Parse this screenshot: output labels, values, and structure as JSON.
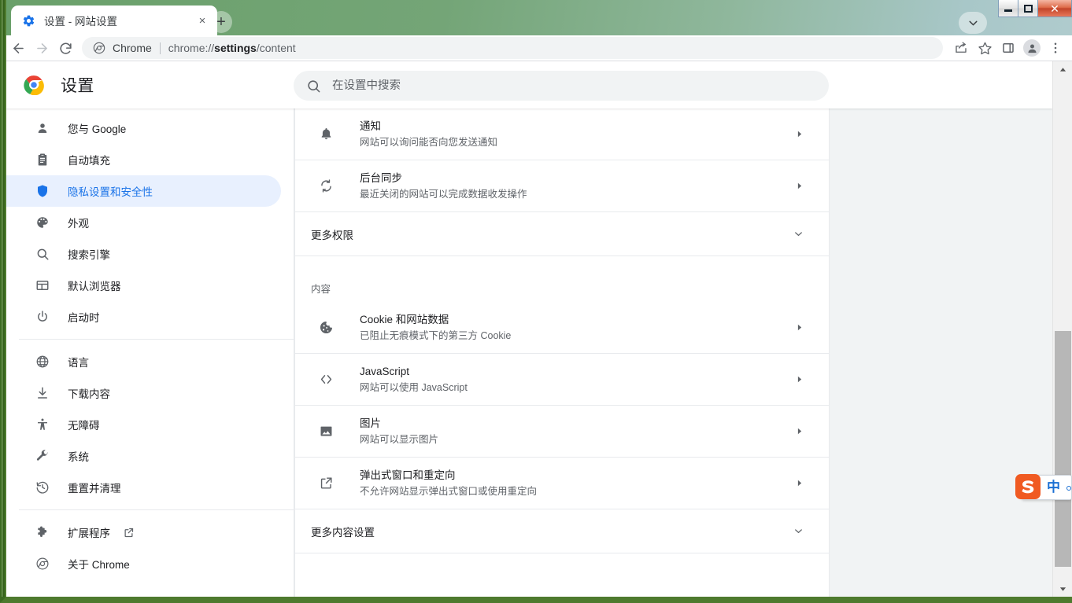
{
  "window": {
    "minimize_label": "Minimize",
    "maximize_label": "Maximize",
    "close_label": "Close"
  },
  "tabstrip": {
    "tab": {
      "title": "设置 - 网站设置",
      "favicon_icon": "gear-icon",
      "close_label": "×"
    },
    "new_tab_label": "+",
    "chevron_icon": "chevron-down-icon"
  },
  "toolbar": {
    "back_icon": "arrow-left-icon",
    "forward_icon": "arrow-right-icon",
    "reload_icon": "reload-icon",
    "omnibox": {
      "site_icon": "chrome-icon",
      "scheme_label": "Chrome",
      "url_prefix": "chrome://",
      "url_bold": "settings",
      "url_suffix": "/content"
    },
    "actions": [
      {
        "name": "share-icon",
        "label": "Share"
      },
      {
        "name": "star-icon",
        "label": "Bookmark"
      },
      {
        "name": "side-panel-icon",
        "label": "Side panel"
      },
      {
        "name": "profile-avatar-icon",
        "label": "Profile"
      },
      {
        "name": "more-vert-icon",
        "label": "More"
      }
    ]
  },
  "settings_header": {
    "logo_icon": "chrome-logo-icon",
    "title": "设置"
  },
  "search": {
    "icon": "search-icon",
    "placeholder": "在设置中搜索",
    "value": ""
  },
  "sidebar": {
    "items": [
      {
        "icon": "person-icon",
        "label": "您与 Google",
        "active": false
      },
      {
        "icon": "clipboard-icon",
        "label": "自动填充",
        "active": false
      },
      {
        "icon": "shield-icon",
        "label": "隐私设置和安全性",
        "active": true
      },
      {
        "icon": "palette-icon",
        "label": "外观",
        "active": false
      },
      {
        "icon": "search-icon",
        "label": "搜索引擎",
        "active": false
      },
      {
        "icon": "browser-icon",
        "label": "默认浏览器",
        "active": false
      },
      {
        "icon": "power-icon",
        "label": "启动时",
        "active": false
      }
    ],
    "items2": [
      {
        "icon": "globe-icon",
        "label": "语言",
        "active": false
      },
      {
        "icon": "download-icon",
        "label": "下载内容",
        "active": false
      },
      {
        "icon": "accessibility-icon",
        "label": "无障碍",
        "active": false
      },
      {
        "icon": "wrench-icon",
        "label": "系统",
        "active": false
      },
      {
        "icon": "history-icon",
        "label": "重置并清理",
        "active": false
      }
    ],
    "items3": [
      {
        "icon": "puzzle-icon",
        "label": "扩展程序",
        "external": true,
        "external_icon": "open-in-new-icon"
      },
      {
        "icon": "chrome-icon",
        "label": "关于 Chrome",
        "external": false
      }
    ]
  },
  "content": {
    "permission_rows": [
      {
        "icon": "bell-icon",
        "title": "通知",
        "subtitle": "网站可以询问能否向您发送通知",
        "arrow": "chevron-right-icon"
      },
      {
        "icon": "sync-icon",
        "title": "后台同步",
        "subtitle": "最近关闭的网站可以完成数据收发操作",
        "arrow": "chevron-right-icon"
      }
    ],
    "more_permissions": {
      "label": "更多权限",
      "arrow": "chevron-down-icon"
    },
    "section_title": "内容",
    "content_rows": [
      {
        "icon": "cookie-icon",
        "title": "Cookie 和网站数据",
        "subtitle": "已阻止无痕模式下的第三方 Cookie",
        "arrow": "chevron-right-icon"
      },
      {
        "icon": "code-icon",
        "title": "JavaScript",
        "subtitle": "网站可以使用 JavaScript",
        "arrow": "chevron-right-icon"
      },
      {
        "icon": "image-icon",
        "title": "图片",
        "subtitle": "网站可以显示图片",
        "arrow": "chevron-right-icon"
      },
      {
        "icon": "popup-icon",
        "title": "弹出式窗口和重定向",
        "subtitle": "不允许网站显示弹出式窗口或使用重定向",
        "arrow": "chevron-right-icon"
      }
    ],
    "more_content": {
      "label": "更多内容设置",
      "arrow": "chevron-down-icon"
    }
  },
  "scrollbar": {
    "up_icon": "triangle-up-icon",
    "down_icon": "triangle-down-icon"
  },
  "ime": {
    "logo_icon": "sogou-logo-icon",
    "mode_label": "中",
    "dot_icon": "circle-icon"
  },
  "colors": {
    "accent": "#1a73e8",
    "accent_bg": "#e8f0fe",
    "text_primary": "#202124",
    "text_secondary": "#5f6368",
    "divider": "#e8eaed",
    "page_bg": "#f1f3f4",
    "frame_green": "#3c6b21"
  }
}
